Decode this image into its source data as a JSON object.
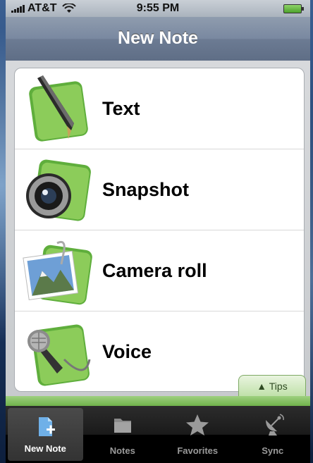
{
  "status": {
    "carrier": "AT&T",
    "time": "9:55 PM"
  },
  "nav": {
    "title": "New Note"
  },
  "list": {
    "items": [
      {
        "label": "Text",
        "icon": "pen-icon"
      },
      {
        "label": "Snapshot",
        "icon": "camera-icon"
      },
      {
        "label": "Camera roll",
        "icon": "photo-icon"
      },
      {
        "label": "Voice",
        "icon": "microphone-icon"
      }
    ]
  },
  "tips": {
    "label": "▲ Tips"
  },
  "tabs": [
    {
      "label": "New Note",
      "icon": "new-note-icon",
      "active": true
    },
    {
      "label": "Notes",
      "icon": "folder-icon",
      "active": false
    },
    {
      "label": "Favorites",
      "icon": "star-icon",
      "active": false
    },
    {
      "label": "Sync",
      "icon": "satellite-icon",
      "active": false
    }
  ],
  "colors": {
    "accent_green": "#6fb24b",
    "nav_blue_gray": "#7988a0"
  }
}
